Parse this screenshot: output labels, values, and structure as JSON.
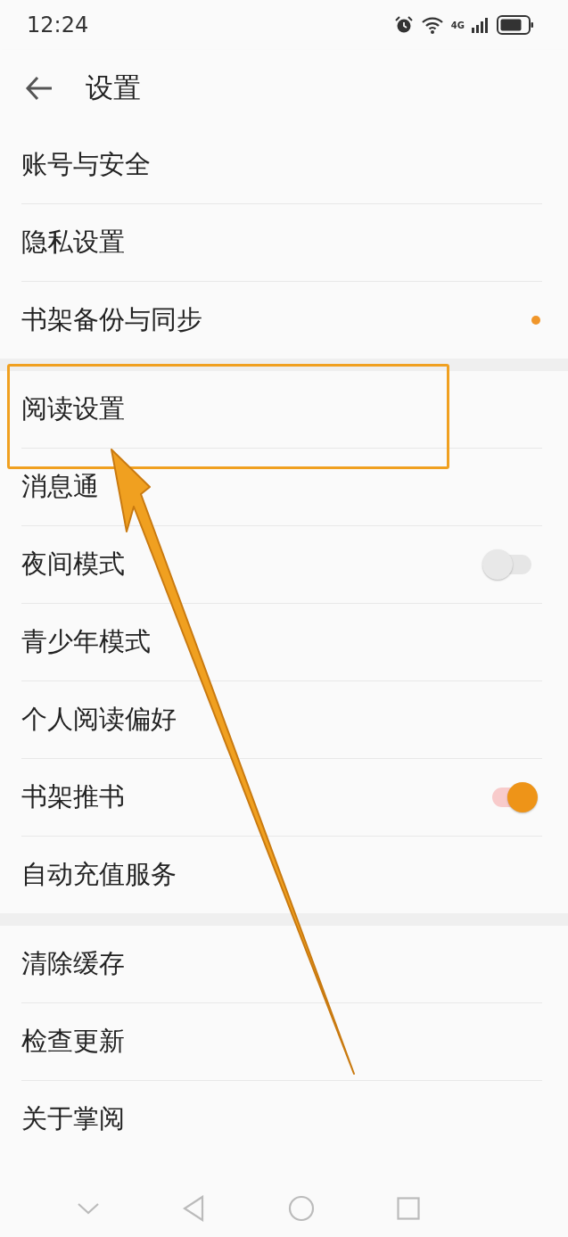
{
  "status_bar": {
    "time": "12:24",
    "network": "4G"
  },
  "header": {
    "title": "设置"
  },
  "groups": [
    {
      "items": [
        {
          "label": "账号与安全",
          "kind": "link"
        },
        {
          "label": "隐私设置",
          "kind": "link"
        },
        {
          "label": "书架备份与同步",
          "kind": "link",
          "badge": true
        }
      ]
    },
    {
      "items": [
        {
          "label": "阅读设置",
          "kind": "link",
          "highlighted": true
        },
        {
          "label": "消息通",
          "kind": "link"
        },
        {
          "label": "夜间模式",
          "kind": "toggle",
          "on": false
        },
        {
          "label": "青少年模式",
          "kind": "link"
        },
        {
          "label": "个人阅读偏好",
          "kind": "link"
        },
        {
          "label": "书架推书",
          "kind": "toggle",
          "on": true
        },
        {
          "label": "自动充值服务",
          "kind": "link"
        }
      ]
    },
    {
      "items": [
        {
          "label": "清除缓存",
          "kind": "link"
        },
        {
          "label": "检查更新",
          "kind": "link"
        },
        {
          "label": "关于掌阅",
          "kind": "link"
        }
      ]
    }
  ]
}
